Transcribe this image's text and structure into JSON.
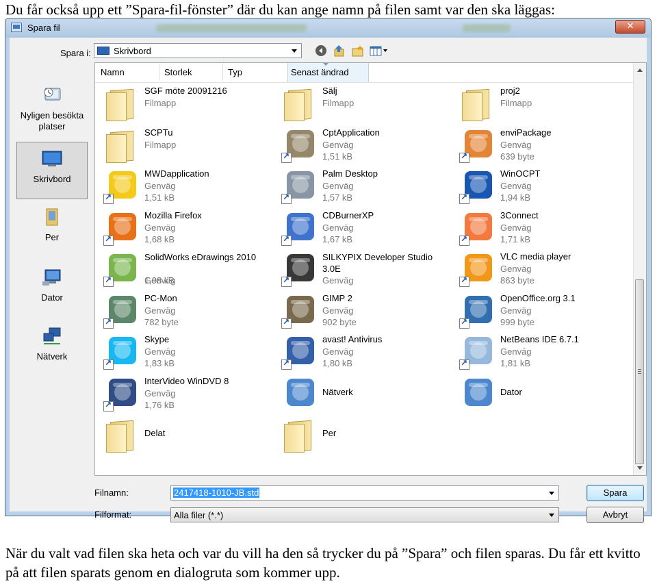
{
  "document": {
    "intro": "Du får också upp ett ”Spara-fil-fönster” där du kan ange namn på filen samt var den ska läggas:",
    "outro": "När du valt vad filen ska heta och var du vill ha den så trycker du på ”Spara” och filen sparas. Du får ett kvitto på att filen sparats genom en dialogruta som kommer upp."
  },
  "dialog": {
    "title": "Spara fil",
    "close": "✕",
    "save_in_label": "Spara i:",
    "location": "Skrivbord",
    "toolbar": [
      "back-icon",
      "up-folder-icon",
      "new-folder-icon",
      "view-menu-icon"
    ]
  },
  "places": [
    {
      "label": "Nyligen besökta platser",
      "icon": "recent-places-icon",
      "selected": false
    },
    {
      "label": "Skrivbord",
      "icon": "desktop-icon",
      "selected": true
    },
    {
      "label": "Per",
      "icon": "user-folder-icon",
      "selected": false
    },
    {
      "label": "Dator",
      "icon": "computer-icon",
      "selected": false
    },
    {
      "label": "Nätverk",
      "icon": "network-icon",
      "selected": false
    }
  ],
  "columns": [
    "Namn",
    "Storlek",
    "Typ",
    "Senast ändrad"
  ],
  "files": [
    {
      "name": "SGF möte 20091216",
      "type": "Filmapp",
      "size": "",
      "icon": "folder-icon",
      "color": "#e8c766"
    },
    {
      "name": "Sälj",
      "type": "Filmapp",
      "size": "",
      "icon": "folder-icon",
      "color": "#e8c766"
    },
    {
      "name": "proj2",
      "type": "Filmapp",
      "size": "",
      "icon": "folder-icon",
      "color": "#e8c766"
    },
    {
      "name": "SCPTu",
      "type": "Filmapp",
      "size": "",
      "icon": "folder-icon",
      "color": "#e8c766"
    },
    {
      "name": "CptApplication",
      "type": "Genväg",
      "size": "1,51 kB",
      "icon": "cpt-application-icon",
      "color": "#8a7a5a"
    },
    {
      "name": "enviPackage",
      "type": "Genväg",
      "size": "639 byte",
      "icon": "java-icon",
      "color": "#e07820"
    },
    {
      "name": "MWDapplication",
      "type": "Genväg",
      "size": "1,51 kB",
      "icon": "bulldozer-icon",
      "color": "#f2c400"
    },
    {
      "name": "Palm Desktop",
      "type": "Genväg",
      "size": "1,57 kB",
      "icon": "palm-desktop-icon",
      "color": "#7a8a9a"
    },
    {
      "name": "WinOCPT",
      "type": "Genväg",
      "size": "1,94 kB",
      "icon": "winocpt-icon",
      "color": "#0044aa"
    },
    {
      "name": "Mozilla Firefox",
      "type": "Genväg",
      "size": "1,68 kB",
      "icon": "firefox-icon",
      "color": "#e66000"
    },
    {
      "name": "CDBurnerXP",
      "type": "Genväg",
      "size": "1,67 kB",
      "icon": "cdburnerxp-icon",
      "color": "#2a64c8"
    },
    {
      "name": "3Connect",
      "type": "Genväg",
      "size": "1,71 kB",
      "icon": "3connect-icon",
      "color": "#f26a2a"
    },
    {
      "name": "SolidWorks eDrawings 2010",
      "type": "Genväg",
      "size": "1,98 kB",
      "icon": "edrawings-icon",
      "color": "#6cae3a"
    },
    {
      "name": "SILKYPIX Developer Studio 3.0E",
      "type": "Genväg",
      "size": "",
      "icon": "silkypix-icon",
      "color": "#222222"
    },
    {
      "name": "VLC media player",
      "type": "Genväg",
      "size": "863 byte",
      "icon": "vlc-icon",
      "color": "#f08c00"
    },
    {
      "name": "PC-Mon",
      "type": "Genväg",
      "size": "782 byte",
      "icon": "pc-mon-icon",
      "color": "#4a7a5a"
    },
    {
      "name": "GIMP 2",
      "type": "Genväg",
      "size": "902 byte",
      "icon": "gimp-icon",
      "color": "#6b5a3a"
    },
    {
      "name": "OpenOffice.org 3.1",
      "type": "Genväg",
      "size": "999 byte",
      "icon": "openoffice-icon",
      "color": "#1c5fa8"
    },
    {
      "name": "Skype",
      "type": "Genväg",
      "size": "1,83 kB",
      "icon": "skype-icon",
      "color": "#00aff0"
    },
    {
      "name": "avast! Antivirus",
      "type": "Genväg",
      "size": "1,80 kB",
      "icon": "avast-icon",
      "color": "#1d4fa0"
    },
    {
      "name": "NetBeans IDE 6.7.1",
      "type": "Genväg",
      "size": "1,81 kB",
      "icon": "netbeans-icon",
      "color": "#8ab0d8"
    },
    {
      "name": "InterVideo WinDVD 8",
      "type": "Genväg",
      "size": "1,76 kB",
      "icon": "windvd-icon",
      "color": "#1a3a7a"
    },
    {
      "name": "Nätverk",
      "type": "",
      "size": "",
      "icon": "network-icon",
      "color": "#3a7ac8"
    },
    {
      "name": "Dator",
      "type": "",
      "size": "",
      "icon": "computer-icon",
      "color": "#3a7ac8"
    },
    {
      "name": "Delat",
      "type": "",
      "size": "",
      "icon": "folder-icon",
      "color": "#e8c766"
    },
    {
      "name": "Per",
      "type": "",
      "size": "",
      "icon": "user-folder-icon",
      "color": "#e8c766"
    }
  ],
  "footer": {
    "filename_label": "Filnamn:",
    "filename_value": "2417418-1010-JB.std",
    "filetype_label": "Filformat:",
    "filetype_value": "Alla filer (*.*)",
    "save_button": "Spara",
    "cancel_button": "Avbryt"
  }
}
